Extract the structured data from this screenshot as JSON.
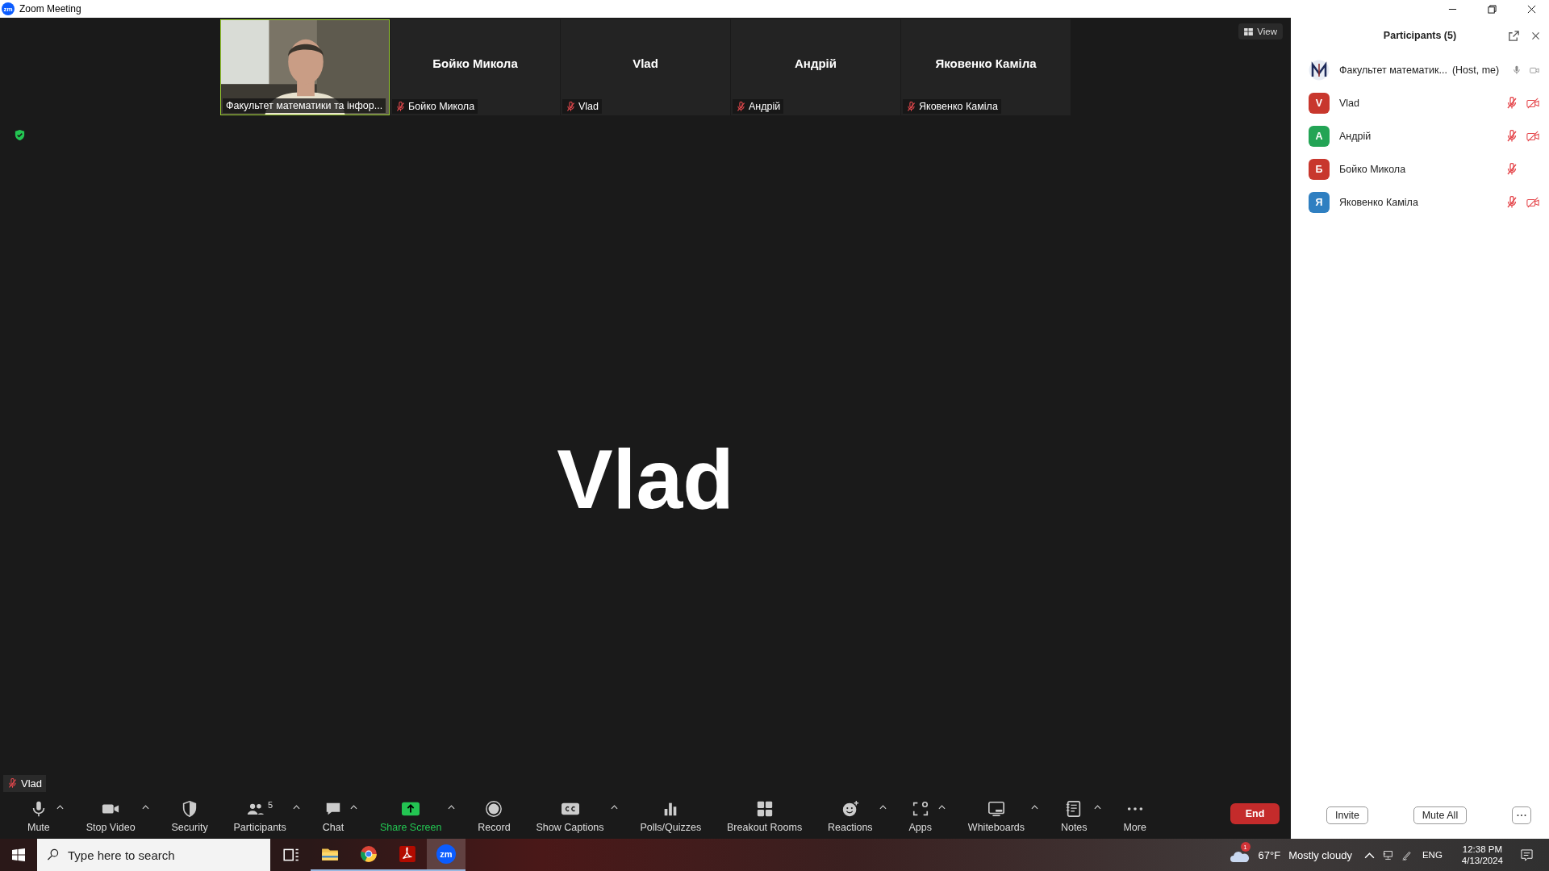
{
  "window": {
    "logo": "zm",
    "title": "Zoom Meeting"
  },
  "tiles": [
    {
      "kind": "video",
      "label": "Факультет математики та інфор...",
      "speaking": true
    },
    {
      "kind": "name",
      "name": "Бойко Микола",
      "label": "Бойко Микола",
      "mic_muted": true,
      "speaking": false
    },
    {
      "kind": "name",
      "name": "Vlad",
      "label": "Vlad",
      "mic_muted": true,
      "speaking": false
    },
    {
      "kind": "name",
      "name": "Андрій",
      "label": "Андрій",
      "mic_muted": true,
      "speaking": false
    },
    {
      "kind": "name",
      "name": "Яковенко Каміла",
      "label": "Яковенко Каміла",
      "mic_muted": true,
      "speaking": false
    }
  ],
  "view_button": "View",
  "stage": {
    "name": "Vlad",
    "label": "Vlad",
    "mic_muted": true
  },
  "toolbar": [
    {
      "kind": "mic",
      "label": "Mute",
      "caret": true
    },
    {
      "kind": "video",
      "label": "Stop Video",
      "caret": true
    },
    {
      "kind": "security",
      "label": "Security",
      "caret": false
    },
    {
      "kind": "participants",
      "label": "Participants",
      "badge": "5",
      "caret": true
    },
    {
      "kind": "chat",
      "label": "Chat",
      "caret": true
    },
    {
      "kind": "share",
      "label": "Share Screen",
      "caret": true
    },
    {
      "kind": "record",
      "label": "Record",
      "caret": false
    },
    {
      "kind": "captions",
      "label": "Show Captions",
      "caret": true
    },
    {
      "kind": "polls",
      "label": "Polls/Quizzes",
      "caret": false
    },
    {
      "kind": "breakout",
      "label": "Breakout Rooms",
      "caret": false
    },
    {
      "kind": "reactions",
      "label": "Reactions",
      "caret": true
    },
    {
      "kind": "apps",
      "label": "Apps",
      "caret": true
    },
    {
      "kind": "whiteboards",
      "label": "Whiteboards",
      "caret": true
    },
    {
      "kind": "notes",
      "label": "Notes",
      "caret": true
    },
    {
      "kind": "more",
      "label": "More",
      "caret": false
    }
  ],
  "end_button": "End",
  "participants_panel": {
    "title": "Participants (5)",
    "participants": [
      {
        "kind": "logo",
        "name": "Факультет математик...",
        "role": "(Host, me)",
        "mic_muted": false,
        "video_off": false
      },
      {
        "kind": "letter",
        "letter": "V",
        "color": "#c8372d",
        "name": "Vlad",
        "mic_muted": true,
        "video_off": true
      },
      {
        "kind": "letter",
        "letter": "А",
        "color": "#23a455",
        "name": "Андрій",
        "mic_muted": true,
        "video_off": true
      },
      {
        "kind": "letter",
        "letter": "Б",
        "color": "#c8372d",
        "name": "Бойко Микола",
        "mic_muted": true
      },
      {
        "kind": "letter",
        "letter": "Я",
        "color": "#2f7fc1",
        "name": "Яковенко Каміла",
        "mic_muted": true,
        "video_off": true
      }
    ],
    "buttons": [
      "Invite",
      "Mute All"
    ]
  },
  "taskbar": {
    "search_placeholder": "Type here to search",
    "apps": [
      {
        "kind": "taskview",
        "running": false,
        "selected": false
      },
      {
        "kind": "explorer",
        "running": true,
        "selected": false
      },
      {
        "kind": "chrome",
        "running": true,
        "selected": false
      },
      {
        "kind": "pdf",
        "running": true,
        "selected": false
      },
      {
        "kind": "zoom",
        "label": "zm",
        "running": true,
        "selected": true
      }
    ],
    "weather_badge": "1",
    "temperature": "67°F",
    "weather": "Mostly cloudy",
    "language": "ENG",
    "time": "12:38 PM",
    "date": "4/13/2024"
  }
}
